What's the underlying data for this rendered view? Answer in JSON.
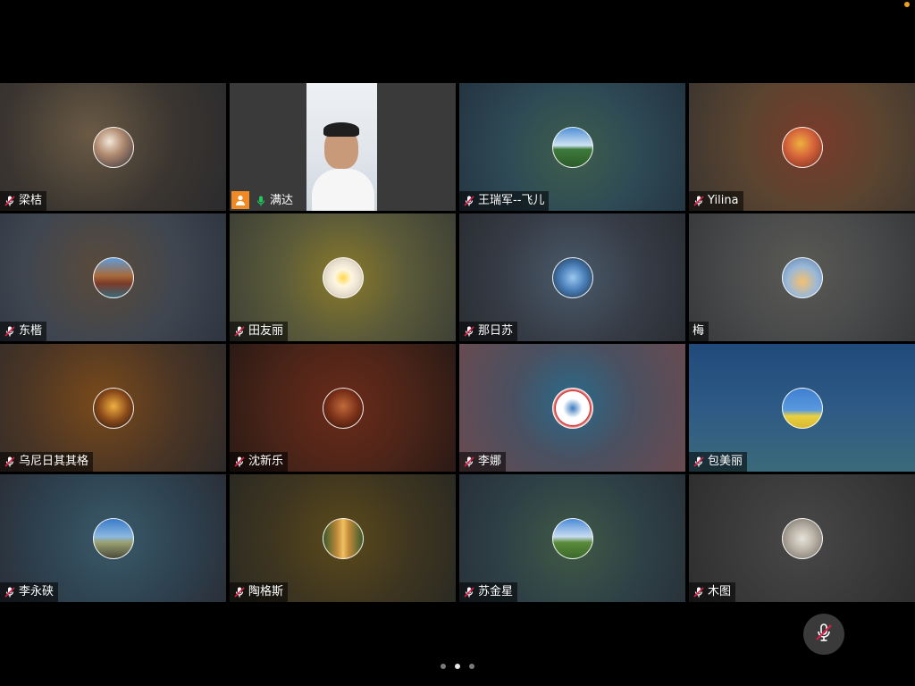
{
  "page": {
    "current_page": 2,
    "total_pages": 3
  },
  "colors": {
    "active_border": "#22c55e",
    "host_badge": "#f08a24",
    "mic_muted": "#e11d48",
    "mic_active": "#22c55e"
  },
  "participants": [
    {
      "name": "梁桔",
      "muted": true
    },
    {
      "name": "满达",
      "muted": false,
      "video_on": true,
      "host": true,
      "active_speaker": true
    },
    {
      "name": "王瑞军--飞儿",
      "muted": true
    },
    {
      "name": "Yilina",
      "muted": true
    },
    {
      "name": "东楷",
      "muted": true
    },
    {
      "name": "田友丽",
      "muted": true
    },
    {
      "name": "那日苏",
      "muted": true
    },
    {
      "name": "梅",
      "muted": false,
      "mic_hidden": true
    },
    {
      "name": "乌尼日其其格",
      "muted": true
    },
    {
      "name": "沈新乐",
      "muted": true
    },
    {
      "name": "李娜",
      "muted": true
    },
    {
      "name": "包美丽",
      "muted": true
    },
    {
      "name": "李永硖",
      "muted": true
    },
    {
      "name": "陶格斯",
      "muted": true
    },
    {
      "name": "苏金星",
      "muted": true
    },
    {
      "name": "木图",
      "muted": true
    }
  ],
  "controls": {
    "mute_button_icon": "mic-muted-icon"
  }
}
